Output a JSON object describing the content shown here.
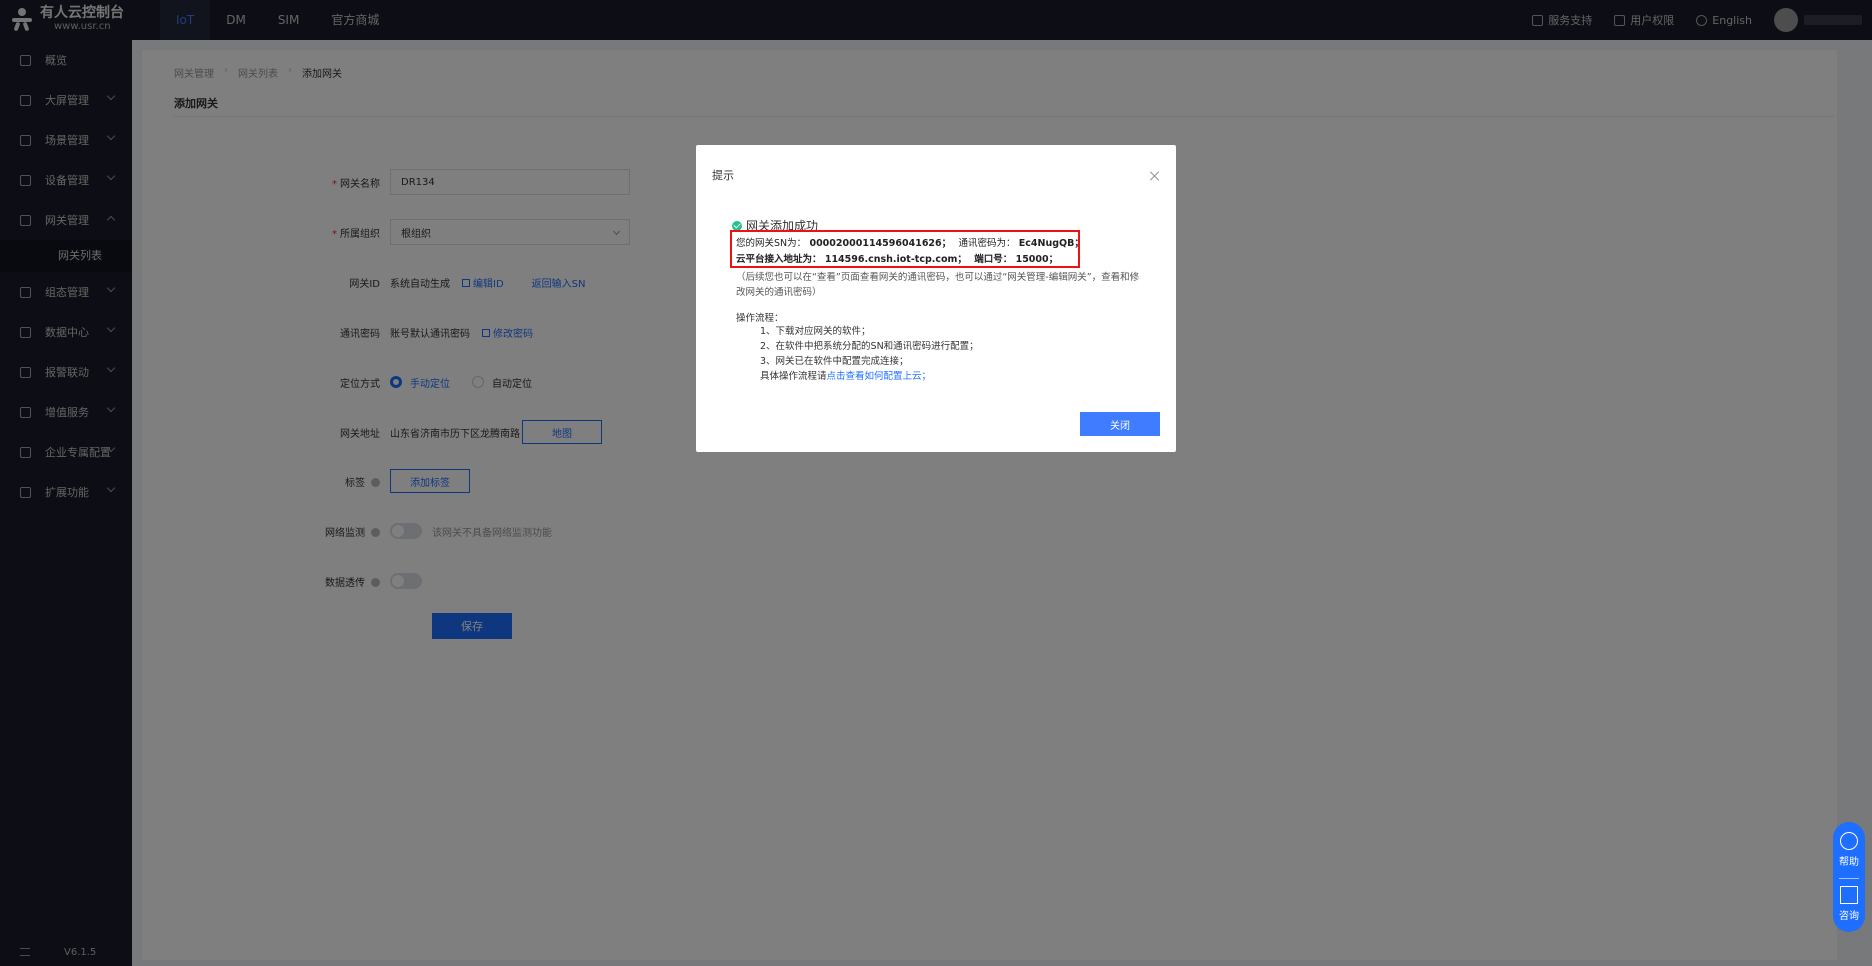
{
  "app": {
    "logo_title": "有人云控制台",
    "logo_sub": "www.usr.cn"
  },
  "topnav": [
    {
      "label": "IoT",
      "active": true
    },
    {
      "label": "DM",
      "active": false
    },
    {
      "label": "SIM",
      "active": false
    },
    {
      "label": "官方商城",
      "active": false
    }
  ],
  "topright": {
    "service": "服务支持",
    "permission": "用户权限",
    "language": "English"
  },
  "sidebar": {
    "items": [
      {
        "label": "概览"
      },
      {
        "label": "大屏管理"
      },
      {
        "label": "场景管理"
      },
      {
        "label": "设备管理"
      },
      {
        "label": "网关管理"
      },
      {
        "label": "网关列表"
      },
      {
        "label": "组态管理"
      },
      {
        "label": "数据中心"
      },
      {
        "label": "报警联动"
      },
      {
        "label": "增值服务"
      },
      {
        "label": "企业专属配置"
      },
      {
        "label": "扩展功能"
      }
    ],
    "version": "V6.1.5"
  },
  "breadcrumb": [
    "网关管理",
    "网关列表",
    "添加网关"
  ],
  "page_title": "添加网关",
  "form": {
    "name_label": "网关名称",
    "name_value": "DR134",
    "org_label": "所属组织",
    "org_value": "根组织",
    "id_label": "网关ID",
    "id_value": "系统自动生成",
    "id_edit": "编辑ID",
    "id_back": "返回输入SN",
    "pwd_label": "通讯密码",
    "pwd_value": "账号默认通讯密码",
    "pwd_edit": "修改密码",
    "loc_label": "定位方式",
    "loc_manual": "手动定位",
    "loc_auto": "自动定位",
    "addr_label": "网关地址",
    "addr_value": "山东省济南市历下区龙腾南路",
    "map_btn": "地图",
    "tag_label": "标签",
    "tag_btn": "添加标签",
    "monitor_label": "网络监测",
    "monitor_hint": "该网关不具备网络监测功能",
    "passthrough_label": "数据透传",
    "save_btn": "保存"
  },
  "float_help": {
    "help": "帮助",
    "consult": "咨询"
  },
  "dialog": {
    "title": "提示",
    "success": "网关添加成功",
    "sn_label": "您的网关SN为：",
    "sn_value": "00002000114596041626；",
    "pwd_label": "通讯密码为：",
    "pwd_value": "Ec4NugQB；",
    "addr_label": "云平台接入地址为：",
    "addr_value": "114596.cnsh.iot-tcp.com；",
    "port_label": "端口号：",
    "port_value": "15000；",
    "note": "（后续您也可以在“查看”页面查看网关的通讯密码，也可以通过“网关管理-编辑网关”，查看和修改网关的通讯密码）",
    "steps_title": "操作流程：",
    "steps": [
      "1、下载对应网关的软件；",
      "2、在软件中把系统分配的SN和通讯密码进行配置；",
      "3、网关已在软件中配置完成连接；"
    ],
    "step_detail": "具体操作流程请",
    "step_link": "点击查看如何配置上云；",
    "close_btn": "关闭"
  }
}
